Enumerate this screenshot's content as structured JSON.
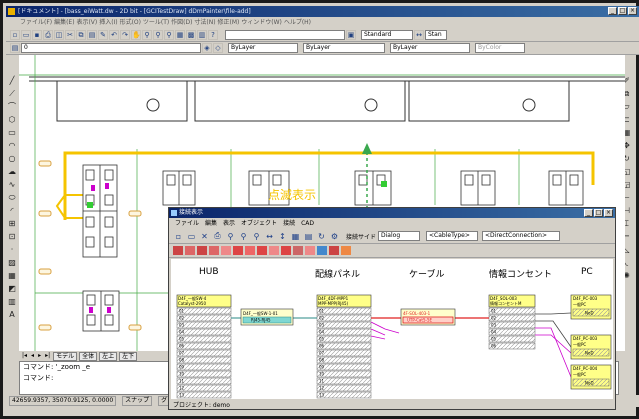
{
  "app": {
    "title": "[ドキュメント] - [bass_eiWatt.dw - 2D bit - [GCITestDraw] dDmPainter\\file-add]",
    "menu": [
      "ファイル(F)",
      "編集(E)",
      "表示(V)",
      "挿入(I)",
      "形式(O)",
      "ツール(T)",
      "作図(D)",
      "寸法(N)",
      "修正(M)",
      "ウィンドウ(W)",
      "ヘルプ(H)"
    ],
    "style_value": "Standard",
    "style_value2": "Stan",
    "layer_value": "0",
    "color_value": "ByLayer",
    "linetype_value": "ByLayer",
    "lineweight_value": "ByLayer",
    "plot_value": "ByColor"
  },
  "canvas": {
    "blink_label": "点滅表示"
  },
  "layout_tabs": {
    "model": "モデル",
    "layout1": "全体",
    "layout2": "左上",
    "layout3": "左下"
  },
  "command": {
    "line1": "コマンド: '_zoom _e",
    "line2": "コマンド:"
  },
  "status_bar": {
    "coords": "42659.9357, 35070.9125, 0.0000",
    "snap": "スナップ",
    "grid": "グリッド"
  },
  "sub_window": {
    "title": "接続表示",
    "menu": [
      "ファイル",
      "編集",
      "表示",
      "オブジェクト",
      "接続",
      "CAD"
    ],
    "toolbar_label1": "接続サイド",
    "toolbar_value1": "Dialog",
    "toolbar_value2": "<CableType>",
    "toolbar_value3": "<DirectConnection>",
    "status_text": "プロジェクト: demo",
    "diagram": {
      "hub_label": "HUB",
      "panel_label": "配線パネル",
      "cable_label": "ケーブル",
      "outlet_label": "情報コンセント",
      "pc_label": "PC",
      "hub_box": {
        "title1": "D4F_一般SW-4",
        "title2": "Catalyst-2950"
      },
      "patch_box": {
        "title": "D4F_一般SW-1-01",
        "row": "RJ45-RJ45"
      },
      "panel_box": {
        "title1": "D4F_4DF-MPP1",
        "title2": "MPP-MPP(RJ45)"
      },
      "cable_box": {
        "title": "4F-SOL-403-1",
        "row": "UTP-Cat5-5E"
      },
      "outlet_box": {
        "title1": "D4F_SOL-003",
        "title2": "情報コンセントM"
      },
      "pc1": {
        "title": "D4F_PC-003",
        "row1": "一般PC",
        "row2": "NoD"
      },
      "pc2": {
        "title": "D4F_PC-003",
        "row1": "一般PC",
        "row2": "NoD"
      },
      "pc3": {
        "title": "D4F_PC-004",
        "row1": "一般PC",
        "row2": "NoD"
      },
      "row_numbers": [
        "01",
        "02",
        "03",
        "04",
        "05",
        "06",
        "07",
        "08",
        "09",
        "10",
        "11",
        "12",
        "13"
      ]
    }
  },
  "colors": {
    "title_bar": "#0a246a",
    "highlight": "#f5c400",
    "cable_red": "#e02020",
    "magenta": "#cc00cc",
    "dashed_green": "#2aa85a",
    "box_yellow": "#ffff88"
  }
}
